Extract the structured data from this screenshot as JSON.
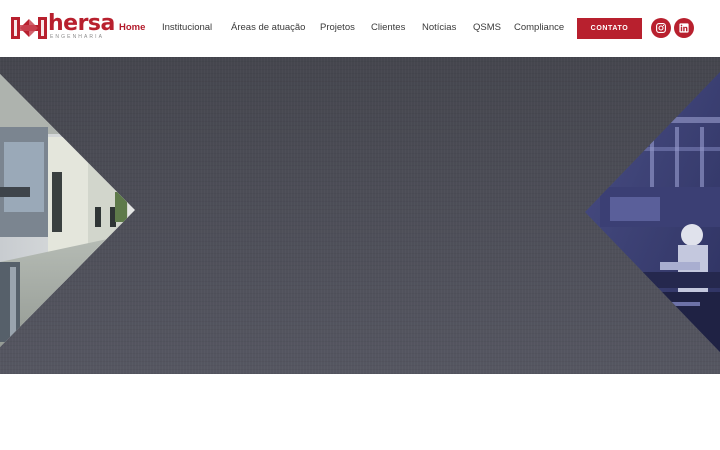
{
  "brand": {
    "name": "hersa",
    "tagline": "ENGENHARIA",
    "color": "#b8202e"
  },
  "nav": {
    "items": [
      {
        "label": "Home",
        "active": true
      },
      {
        "label": "Institucional",
        "active": false
      },
      {
        "label": "Áreas de atuação",
        "active": false
      },
      {
        "label": "Projetos",
        "active": false
      },
      {
        "label": "Clientes",
        "active": false
      },
      {
        "label": "Notícias",
        "active": false
      },
      {
        "label": "QSMS",
        "active": false
      },
      {
        "label": "Compliance",
        "active": false
      }
    ],
    "active_color": "#b31b2b"
  },
  "cta": {
    "contact_label": "CONTATO"
  },
  "social": [
    {
      "icon": "instagram-icon"
    },
    {
      "icon": "linkedin-icon"
    }
  ],
  "hero": {
    "background_color": "#4b4c54",
    "left_photo": "hospital-corridor-photo",
    "right_photo": "industrial-worker-photo"
  }
}
